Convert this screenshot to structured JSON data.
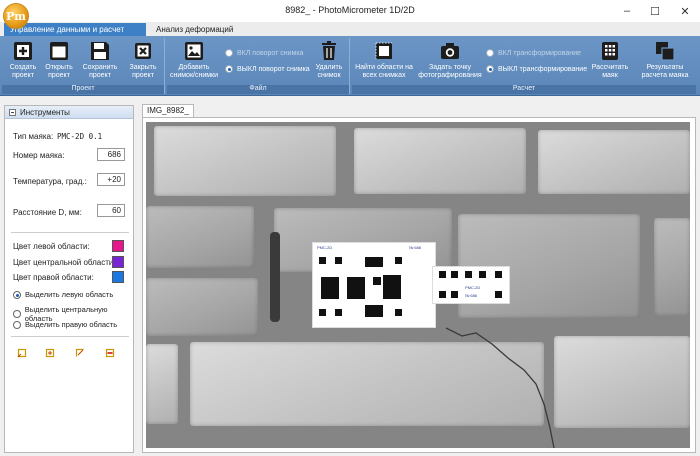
{
  "window": {
    "title": "8982_ - PhotoMicrometer 1D/2D",
    "app_logo": "Pm",
    "controls": [
      "minimize-icon",
      "maximize-icon",
      "close-icon"
    ]
  },
  "tabs": [
    {
      "label": "Управление данными и расчет",
      "active": true
    },
    {
      "label": "Анализ деформаций",
      "active": false
    }
  ],
  "ribbon": {
    "groups": {
      "project": "Проект",
      "file": "Файл",
      "calc": "Расчет"
    },
    "buttons": {
      "create": "Создать проект",
      "open": "Открыть проект",
      "save": "Сохранить проект",
      "close": "Закрыть проект",
      "add_image": "Добавить снимок/снимки",
      "delete_image": "Удалить снимок",
      "find_regions": "Найти области на всех снимках",
      "set_point": "Задать точку фотографирования",
      "calc_marker": "Рассчитать маяк",
      "results": "Результаты расчета маяка"
    },
    "radios": {
      "rotate_on": "ВКЛ поворот снимка",
      "rotate_off": "ВЫКЛ поворот снимка",
      "transform_on": "ВКЛ трансформирование",
      "transform_off": "ВЫКЛ трансформирование"
    },
    "selected": {
      "rotate": "off",
      "transform": "off"
    }
  },
  "panel": {
    "title": "Инструменты",
    "marker_type_label": "Тип маяка:",
    "marker_type_value": "РМС-2D 0.1",
    "fields": [
      {
        "label": "Номер маяка:",
        "value": "686"
      },
      {
        "label": "Температура, град.:",
        "value": "+20"
      },
      {
        "label": "Расстояние D, мм:",
        "value": "60"
      }
    ],
    "colors": [
      {
        "label": "Цвет левой области:",
        "color": "#e8168c"
      },
      {
        "label": "Цвет центральной области:",
        "color": "#7b22d6"
      },
      {
        "label": "Цвет правой области:",
        "color": "#1a78e0"
      }
    ],
    "region_options": [
      {
        "label": "Выделить левую область",
        "selected": true
      },
      {
        "label": "Выделить центральную область",
        "selected": false
      },
      {
        "label": "Выделить правую область",
        "selected": false
      }
    ],
    "tools": [
      "region-select-icon",
      "region-move-icon",
      "region-adjust-icon",
      "region-delete-icon"
    ]
  },
  "image": {
    "tab_label": "IMG_8982_",
    "target_labels": {
      "left_title": "РМС-2D",
      "left_number": "№ 686",
      "right_title": "РМС-2D",
      "right_number": "№ 686"
    }
  }
}
